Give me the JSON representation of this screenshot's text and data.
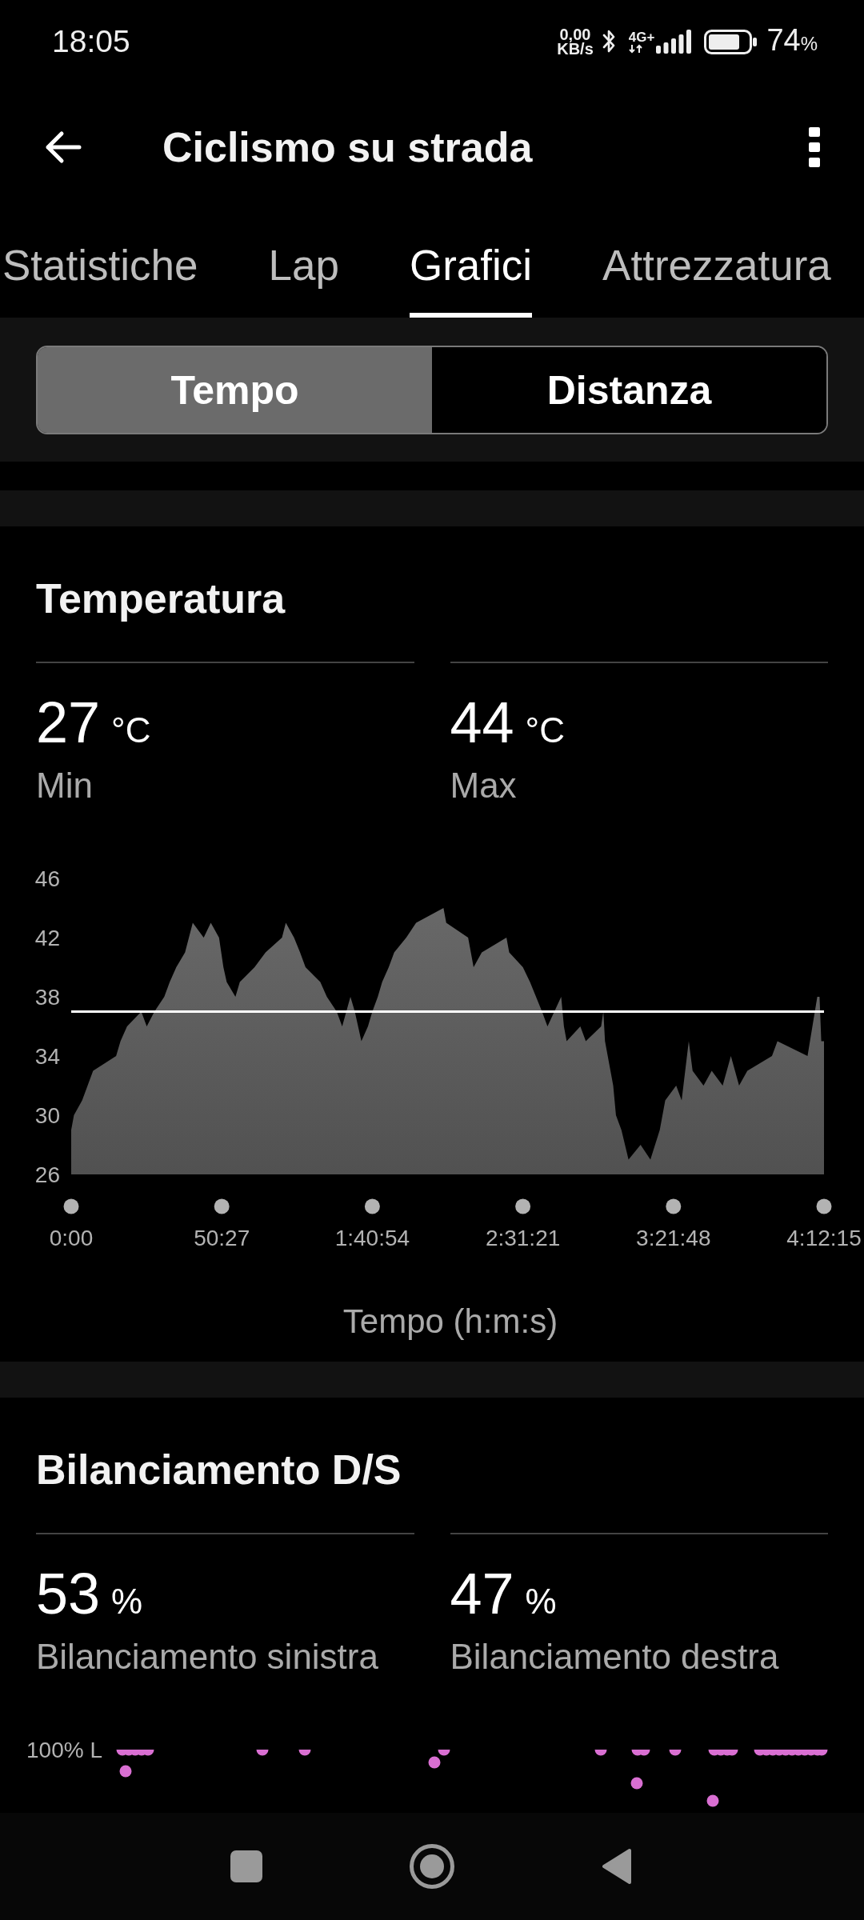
{
  "status_bar": {
    "time": "18:05",
    "net_speed": "0,00",
    "net_speed_unit": "KB/s",
    "network_type": "4G+",
    "battery_text": "74",
    "battery_unit": "%"
  },
  "app_bar": {
    "title": "Ciclismo su strada"
  },
  "tabs": [
    {
      "label": "Statistiche",
      "selected": false
    },
    {
      "label": "Lap",
      "selected": false
    },
    {
      "label": "Grafici",
      "selected": true
    },
    {
      "label": "Attrezzatura",
      "selected": false
    }
  ],
  "segments": [
    {
      "label": "Tempo",
      "selected": true
    },
    {
      "label": "Distanza",
      "selected": false
    }
  ],
  "cards": [
    {
      "kind": "area_chart",
      "title": "Temperatura",
      "stats": [
        {
          "value": "27",
          "unit": "°C",
          "label": "Min"
        },
        {
          "value": "44",
          "unit": "°C",
          "label": "Max"
        }
      ],
      "chart_data": {
        "type": "area",
        "xlabel": "Tempo (h:m:s)",
        "x": [
          0,
          55,
          220,
          330,
          440,
          903,
          991,
          1123,
          1409,
          1519,
          1673,
          1871,
          1981,
          2113,
          2289,
          2444,
          2664,
          2807,
          2972,
          3060,
          3126,
          3302,
          3390,
          3687,
          3908,
          4238,
          4315,
          4480,
          4601,
          4711,
          5008,
          5140,
          5338,
          5448,
          5614,
          5702,
          5834,
          5966,
          6054,
          6164,
          6252,
          6384,
          6494,
          6736,
          6934,
          7485,
          7540,
          7980,
          8090,
          8255,
          8751,
          8806,
          9081,
          9224,
          9466,
          9576,
          9851,
          9906,
          9961,
          10236,
          10346,
          10654,
          10699,
          10732,
          10842,
          10897,
          10952,
          11062,
          11205,
          11447,
          11645,
          11833,
          11888,
          11943,
          12163,
          12273,
          12416,
          12493,
          12713,
          12878,
          13098,
          13263,
          13428,
          13594,
          14089,
          14199,
          14804,
          15000,
          15045,
          15080,
          15135
        ],
        "series": [
          {
            "color": "#686868",
            "values": [
              29,
              30,
              31,
              32,
              33,
              34,
              35,
              36,
              37,
              36,
              37,
              38,
              39,
              40,
              41,
              43,
              42,
              43,
              42,
              40,
              39,
              38,
              39,
              40,
              41,
              42,
              43,
              42,
              41,
              40,
              39,
              38,
              37,
              36,
              38,
              37,
              35,
              36,
              37,
              38,
              39,
              40,
              41,
              42,
              43,
              44,
              43,
              42,
              40,
              41,
              42,
              41,
              40,
              39,
              37,
              36,
              38,
              36,
              35,
              36,
              35,
              36,
              37,
              35,
              33,
              32,
              30,
              29,
              27,
              28,
              27,
              29,
              30,
              31,
              32,
              31,
              35,
              33,
              32,
              33,
              32,
              34,
              32,
              33,
              34,
              35,
              34,
              38,
              38,
              35,
              35
            ]
          }
        ],
        "xlim": [
          0,
          15135
        ],
        "ylim": [
          26,
          46
        ],
        "yticks": [
          26,
          30,
          34,
          38,
          42,
          46
        ],
        "xticks": [
          {
            "value": 0,
            "label": "0:00"
          },
          {
            "value": 3027,
            "label": "50:27"
          },
          {
            "value": 6054,
            "label": "1:40:54"
          },
          {
            "value": 9081,
            "label": "2:31:21"
          },
          {
            "value": 12108,
            "label": "3:21:48"
          },
          {
            "value": 15135,
            "label": "4:12:15"
          }
        ],
        "ref_lines": [
          {
            "axis": "y",
            "value": 37
          }
        ]
      }
    },
    {
      "kind": "dot_chart",
      "title": "Bilanciamento D/S",
      "stats": [
        {
          "value": "53",
          "unit": "%",
          "label": "Bilanciamento sinistra"
        },
        {
          "value": "47",
          "unit": "%",
          "label": "Bilanciamento destra"
        }
      ],
      "axis_label": "100% L"
    }
  ]
}
